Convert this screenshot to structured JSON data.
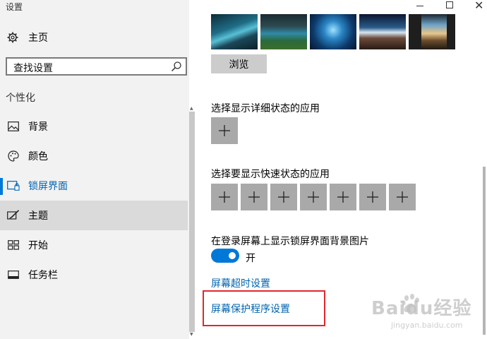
{
  "window": {
    "title": "设置"
  },
  "sidebar": {
    "home_label": "主页",
    "search_placeholder": "查找设置",
    "section_title": "个性化",
    "items": [
      {
        "label": "背景",
        "icon": "picture-icon"
      },
      {
        "label": "颜色",
        "icon": "palette-icon"
      },
      {
        "label": "锁屏界面",
        "icon": "lock-screen-icon",
        "active": true
      },
      {
        "label": "主题",
        "icon": "theme-brush-icon",
        "hover": true
      },
      {
        "label": "开始",
        "icon": "start-grid-icon"
      },
      {
        "label": "任务栏",
        "icon": "taskbar-icon"
      }
    ]
  },
  "main": {
    "browse_label": "浏览",
    "detailed_status_heading": "选择显示详细状态的应用",
    "quick_status_heading": "选择要显示快速状态的应用",
    "show_bg_heading": "在登录屏幕上显示锁屏界面背景图片",
    "toggle_state_label": "开",
    "toggle_on": true,
    "screen_timeout_link": "屏幕超时设置",
    "screensaver_link": "屏幕保护程序设置",
    "quick_status_slot_count": 7
  },
  "watermark": {
    "brand": "Baidu经验",
    "url": "jingyan.baidu.com"
  },
  "colors": {
    "accent": "#0078d7",
    "link": "#0063b1",
    "highlight_frame": "#e0282e",
    "sidebar_bg": "#f2f2f2",
    "tile_bg": "#a9a9a9"
  }
}
